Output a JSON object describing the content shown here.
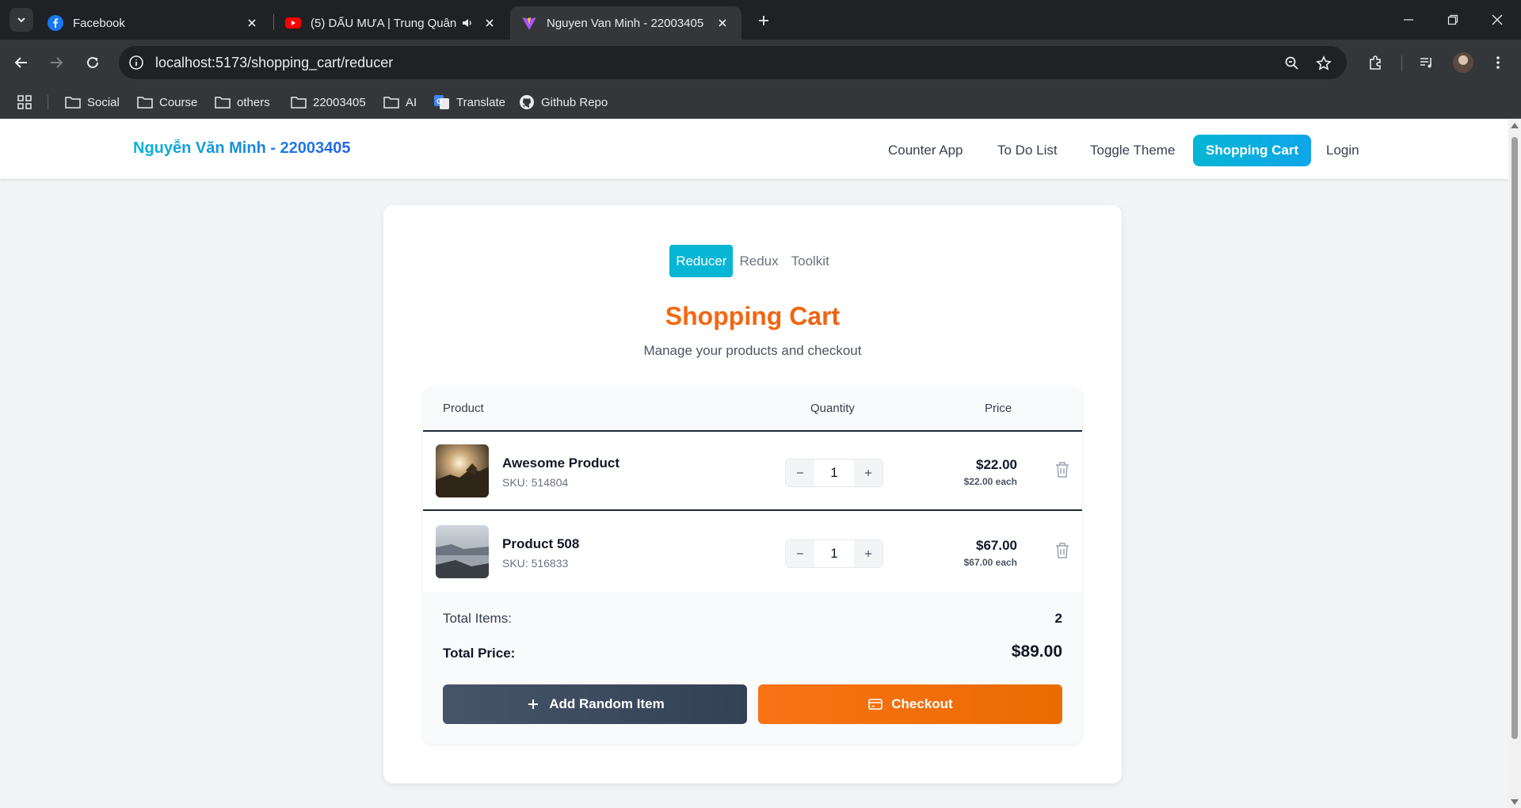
{
  "browser": {
    "tabs": [
      {
        "title": "Facebook",
        "active": false
      },
      {
        "title": "(5) DẤU MƯA | Trung Quân",
        "active": false
      },
      {
        "title": "Nguyen Van Minh - 22003405",
        "active": true
      }
    ],
    "url": "localhost:5173/shopping_cart/reducer",
    "bookmarks": [
      "Social",
      "Course",
      "others",
      "22003405",
      "AI",
      "Translate",
      "Github Repo"
    ]
  },
  "header": {
    "brand": "Nguyễn Văn Minh - 22003405",
    "nav": [
      {
        "label": "Counter App",
        "active": false
      },
      {
        "label": "To Do List",
        "active": false
      },
      {
        "label": "Toggle Theme",
        "active": false
      },
      {
        "label": "Shopping Cart",
        "active": true
      },
      {
        "label": "Login",
        "active": false
      }
    ]
  },
  "cart": {
    "modes": [
      {
        "label": "Reducer",
        "active": true
      },
      {
        "label": "Redux",
        "active": false
      },
      {
        "label": "Toolkit",
        "active": false
      }
    ],
    "title": "Shopping Cart",
    "subtitle": "Manage your products and checkout",
    "columns": {
      "product": "Product",
      "quantity": "Quantity",
      "price": "Price"
    },
    "items": [
      {
        "name": "Awesome Product",
        "sku": "SKU: 514804",
        "quantity": "1",
        "total": "$22.00",
        "each": "$22.00 each"
      },
      {
        "name": "Product 508",
        "sku": "SKU: 516833",
        "quantity": "1",
        "total": "$67.00",
        "each": "$67.00 each"
      }
    ],
    "summary": {
      "items_label": "Total Items:",
      "items_value": "2",
      "price_label": "Total Price:",
      "price_value": "$89.00"
    },
    "buttons": {
      "add": "Add Random Item",
      "checkout": "Checkout"
    }
  },
  "colors": {
    "accent": "#06b6d4",
    "brand_end": "#2563eb",
    "title_orange": "#f97316",
    "dark_button": "#334155"
  },
  "icons": [
    "facebook-icon",
    "youtube-icon",
    "vite-icon",
    "speaker-icon",
    "search-icon",
    "star-icon",
    "extensions-icon",
    "media-icon",
    "folder-icon",
    "translate-icon",
    "github-icon",
    "trash-icon",
    "plus-icon",
    "credit-card-icon"
  ]
}
